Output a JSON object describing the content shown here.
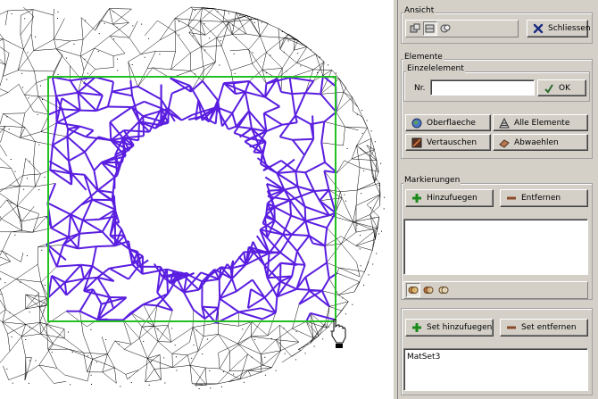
{
  "panel": {
    "ansicht": {
      "title": "Ansicht",
      "view_icons": [
        "view-front-icon",
        "view-perspective-icon",
        "view-side-icon"
      ],
      "close_label": "Schliessen"
    },
    "elemente": {
      "title": "Elemente",
      "einzelelement": {
        "title": "Einzelelement",
        "nr_label": "Nr.",
        "nr_value": "",
        "ok_label": "OK"
      },
      "buttons": {
        "oberflaeche": "Oberflaeche",
        "alle_elemente": "Alle Elemente",
        "vertauschen": "Vertauschen",
        "abwaehlen": "Abwaehlen"
      }
    },
    "markierungen": {
      "title": "Markierungen",
      "hinzufuegen_label": "Hinzufuegen",
      "entfernen_label": "Entfernen",
      "list_items": [],
      "mode_icons": [
        "intersect-icon",
        "union-icon",
        "subtract-icon"
      ]
    },
    "sets": {
      "set_hinzufuegen_label": "Set hinzufuegen",
      "set_entfernen_label": "Set entfernen",
      "list_items": [
        "MatSet3"
      ]
    }
  },
  "colors": {
    "mesh_lines": "#000000",
    "selected_elements": "#5a1ee0",
    "selection_rectangle": "#22c022",
    "panel_bg": "#d4d0c8"
  }
}
